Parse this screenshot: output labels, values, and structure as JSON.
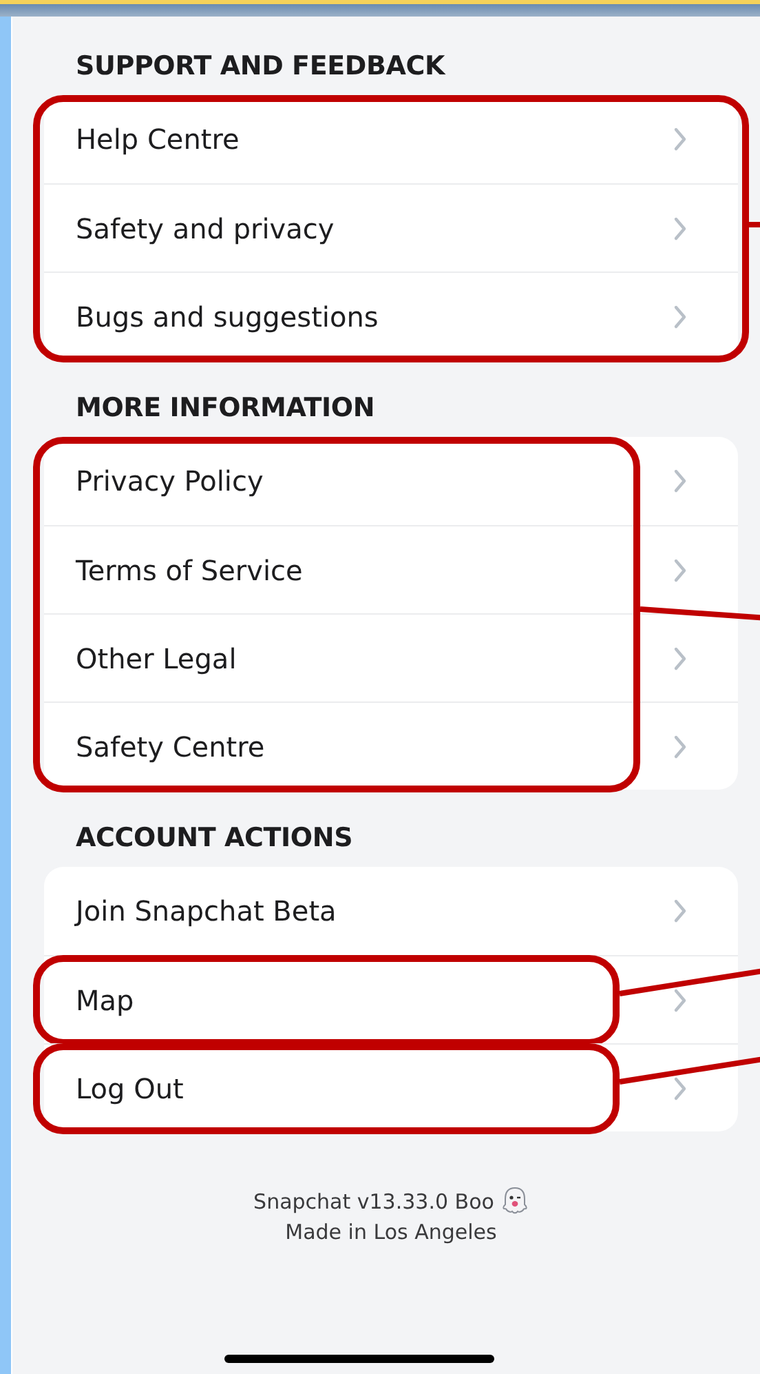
{
  "sections": [
    {
      "heading": "SUPPORT AND FEEDBACK",
      "groups": [
        {
          "kind": "wide",
          "rows": [
            {
              "label": "Help Centre"
            },
            {
              "label": "Safety and privacy"
            },
            {
              "label": "Bugs and suggestions"
            }
          ]
        }
      ]
    },
    {
      "heading": "MORE INFORMATION",
      "groups": [
        {
          "kind": "narrow",
          "rows": [
            {
              "label": "Privacy Policy"
            },
            {
              "label": "Terms of Service"
            },
            {
              "label": "Other Legal"
            },
            {
              "label": "Safety Centre"
            }
          ]
        }
      ]
    },
    {
      "heading": "ACCOUNT ACTIONS",
      "groups": [
        {
          "kind": "plain",
          "rows": [
            {
              "label": "Join Snapchat Beta"
            }
          ]
        },
        {
          "kind": "row",
          "rows": [
            {
              "label": "Map"
            }
          ]
        },
        {
          "kind": "row",
          "rows": [
            {
              "label": "Log Out"
            }
          ]
        }
      ]
    }
  ],
  "footer": {
    "version": "Snapchat v13.33.0 Boo",
    "location": "Made in Los Angeles"
  }
}
